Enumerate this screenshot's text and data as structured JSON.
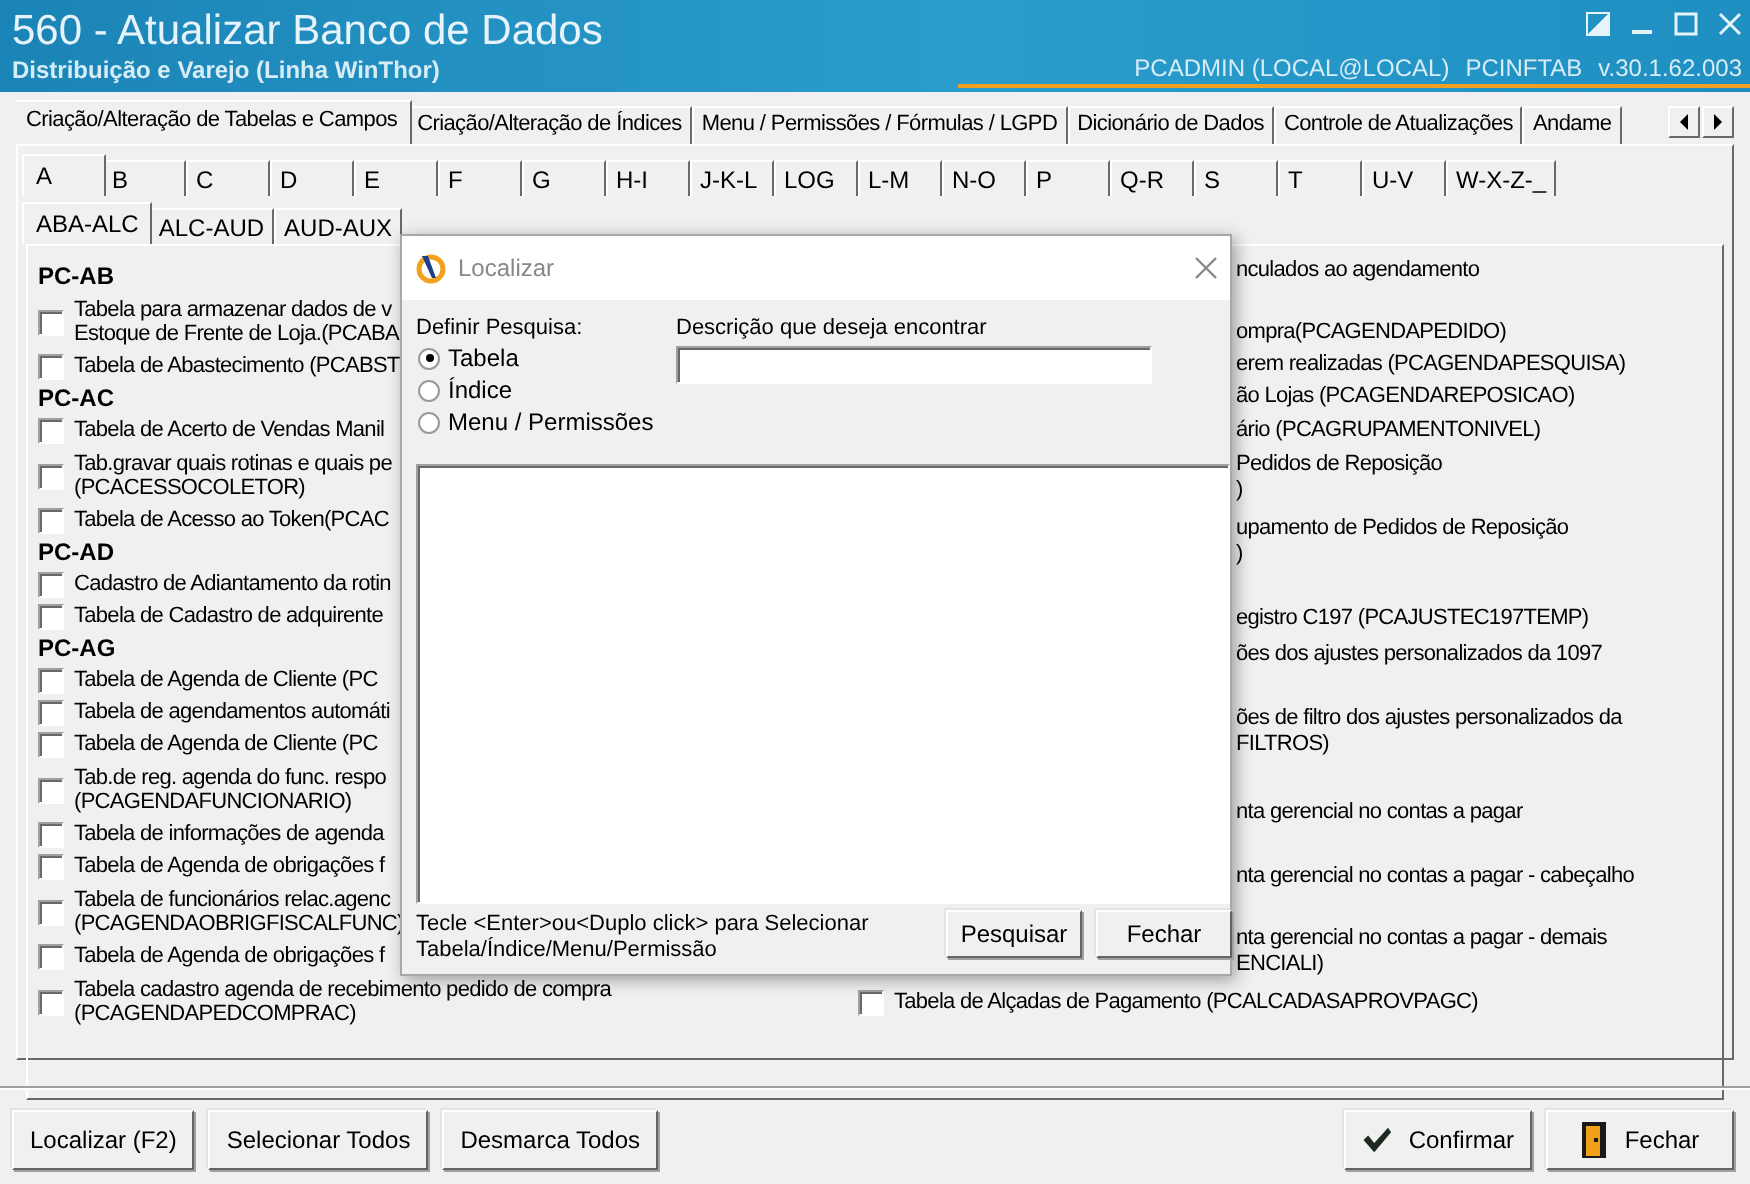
{
  "window": {
    "title": "560 - Atualizar Banco de Dados",
    "subtitle": "Distribuição e Varejo (Linha WinThor)",
    "user": "PCADMIN (LOCAL@LOCAL)",
    "module": "PCINFTAB",
    "version": "v.30.1.62.003"
  },
  "main_tabs": [
    {
      "label": "Criação/Alteração de Tabelas e Campos",
      "selected": true
    },
    {
      "label": "Criação/Alteração de Índices",
      "selected": false
    },
    {
      "label": "Menu / Permissões / Fórmulas / LGPD",
      "selected": false
    },
    {
      "label": "Dicionário de Dados",
      "selected": false
    },
    {
      "label": "Controle de Atualizações",
      "selected": false
    },
    {
      "label": "Andame",
      "selected": false
    }
  ],
  "letter_tabs": [
    {
      "label": "A",
      "selected": true
    },
    {
      "label": "B",
      "selected": false
    },
    {
      "label": "C",
      "selected": false
    },
    {
      "label": "D",
      "selected": false
    },
    {
      "label": "E",
      "selected": false
    },
    {
      "label": "F",
      "selected": false
    },
    {
      "label": "G",
      "selected": false
    },
    {
      "label": "H-I",
      "selected": false
    },
    {
      "label": "J-K-L",
      "selected": false
    },
    {
      "label": "LOG",
      "selected": false
    },
    {
      "label": "L-M",
      "selected": false
    },
    {
      "label": "N-O",
      "selected": false
    },
    {
      "label": "P",
      "selected": false
    },
    {
      "label": "Q-R",
      "selected": false
    },
    {
      "label": "S",
      "selected": false
    },
    {
      "label": "T",
      "selected": false
    },
    {
      "label": "U-V",
      "selected": false
    },
    {
      "label": "W-X-Z-_",
      "selected": false
    }
  ],
  "sub_tabs": [
    {
      "label": "ABA-ALC",
      "selected": true
    },
    {
      "label": "ALC-AUD",
      "selected": false
    },
    {
      "label": "AUD-AUX",
      "selected": false
    }
  ],
  "left_column": [
    {
      "kind": "group",
      "label": "PC-AB"
    },
    {
      "kind": "table",
      "lines": [
        "Tabela para armazenar dados de v",
        "Estoque de Frente de Loja.(PCABA"
      ],
      "checked": false
    },
    {
      "kind": "table",
      "lines": [
        "Tabela de Abastecimento (PCABST"
      ],
      "checked": false
    },
    {
      "kind": "group",
      "label": "PC-AC"
    },
    {
      "kind": "table",
      "lines": [
        "Tabela de Acerto de Vendas Manil"
      ],
      "checked": false
    },
    {
      "kind": "table",
      "lines": [
        "Tab.gravar quais rotinas e quais pe",
        "(PCACESSOCOLETOR)"
      ],
      "checked": false
    },
    {
      "kind": "table",
      "lines": [
        "Tabela de Acesso ao Token(PCAC"
      ],
      "checked": false
    },
    {
      "kind": "group",
      "label": "PC-AD"
    },
    {
      "kind": "table",
      "lines": [
        "Cadastro de Adiantamento da rotin"
      ],
      "checked": false
    },
    {
      "kind": "table",
      "lines": [
        "Tabela de Cadastro de adquirente"
      ],
      "checked": false
    },
    {
      "kind": "group",
      "label": "PC-AG"
    },
    {
      "kind": "table",
      "lines": [
        "Tabela  de Agenda de Cliente (PC"
      ],
      "checked": false
    },
    {
      "kind": "table",
      "lines": [
        "Tabela de agendamentos automáti"
      ],
      "checked": false
    },
    {
      "kind": "table",
      "lines": [
        "Tabela  de Agenda de Cliente (PC"
      ],
      "checked": false
    },
    {
      "kind": "table",
      "lines": [
        "Tab.de reg. agenda do func. respo",
        "(PCAGENDAFUNCIONARIO)"
      ],
      "checked": false
    },
    {
      "kind": "table",
      "lines": [
        "Tabela de informações de agenda"
      ],
      "checked": false
    },
    {
      "kind": "table",
      "lines": [
        "Tabela de Agenda de obrigações f"
      ],
      "checked": false
    },
    {
      "kind": "table",
      "lines": [
        "Tabela de funcionários relac.agenc",
        "(PCAGENDAOBRIGFISCALFUNC)"
      ],
      "checked": false
    },
    {
      "kind": "table",
      "lines": [
        "Tabela de Agenda de obrigações f"
      ],
      "checked": false
    },
    {
      "kind": "table",
      "lines": [
        "Tabela cadastro agenda de recebimento pedido de compra",
        "(PCAGENDAPEDCOMPRAC)"
      ],
      "checked": false
    }
  ],
  "right_column": [
    {
      "kind": "fragment",
      "lines": [
        "nculados ao agendamento"
      ]
    },
    {
      "kind": "fragment",
      "lines": [
        "ompra(PCAGENDAPEDIDO)"
      ]
    },
    {
      "kind": "fragment",
      "lines": [
        "erem realizadas (PCAGENDAPESQUISA)"
      ]
    },
    {
      "kind": "fragment",
      "lines": [
        "ão Lojas (PCAGENDAREPOSICAO)"
      ]
    },
    {
      "kind": "fragment",
      "lines": [
        "ário (PCAGRUPAMENTONIVEL)"
      ]
    },
    {
      "kind": "fragment",
      "lines": [
        "Pedidos de Reposição",
        ")"
      ]
    },
    {
      "kind": "fragment",
      "lines": [
        "upamento de Pedidos de Reposição",
        ")"
      ]
    },
    {
      "kind": "fragment",
      "lines": [
        "egistro C197 (PCAJUSTEC197TEMP)"
      ]
    },
    {
      "kind": "fragment",
      "lines": [
        "ões dos ajustes personalizados da 1097"
      ]
    },
    {
      "kind": "fragment",
      "lines": [
        "ões de filtro dos ajustes personalizados da",
        "FILTROS)"
      ]
    },
    {
      "kind": "fragment",
      "lines": [
        "nta gerencial no contas a pagar"
      ]
    },
    {
      "kind": "fragment",
      "lines": [
        "nta gerencial no contas a pagar - cabeçalho"
      ]
    },
    {
      "kind": "fragment",
      "lines": [
        "nta gerencial no contas a pagar - demais",
        "ENCIALI)"
      ]
    },
    {
      "kind": "table",
      "lines": [
        "Tabela de Alçadas de Pagamento (PCALCADASAPROVPAGC)"
      ],
      "checked": false
    }
  ],
  "dialog": {
    "title": "Localizar",
    "search_label": "Definir Pesquisa:",
    "options": [
      {
        "label": "Tabela",
        "selected": true
      },
      {
        "label": "Índice",
        "selected": false
      },
      {
        "label": "Menu / Permissões",
        "selected": false
      }
    ],
    "description_label": "Descrição que deseja encontrar",
    "hint": [
      "Tecle <Enter>ou<Duplo click> para Selecionar",
      "Tabela/Índice/Menu/Permissão"
    ],
    "buttons": [
      {
        "label": "Pesquisar"
      },
      {
        "label": "Fechar"
      }
    ]
  },
  "buttons": [
    {
      "kind": "plain",
      "label": "Localizar (F2)"
    },
    {
      "kind": "plain",
      "label": "Selecionar Todos"
    },
    {
      "kind": "plain",
      "label": "Desmarca Todos"
    },
    {
      "kind": "confirm",
      "label": "Confirmar"
    },
    {
      "kind": "exit",
      "label": "Fechar"
    }
  ]
}
